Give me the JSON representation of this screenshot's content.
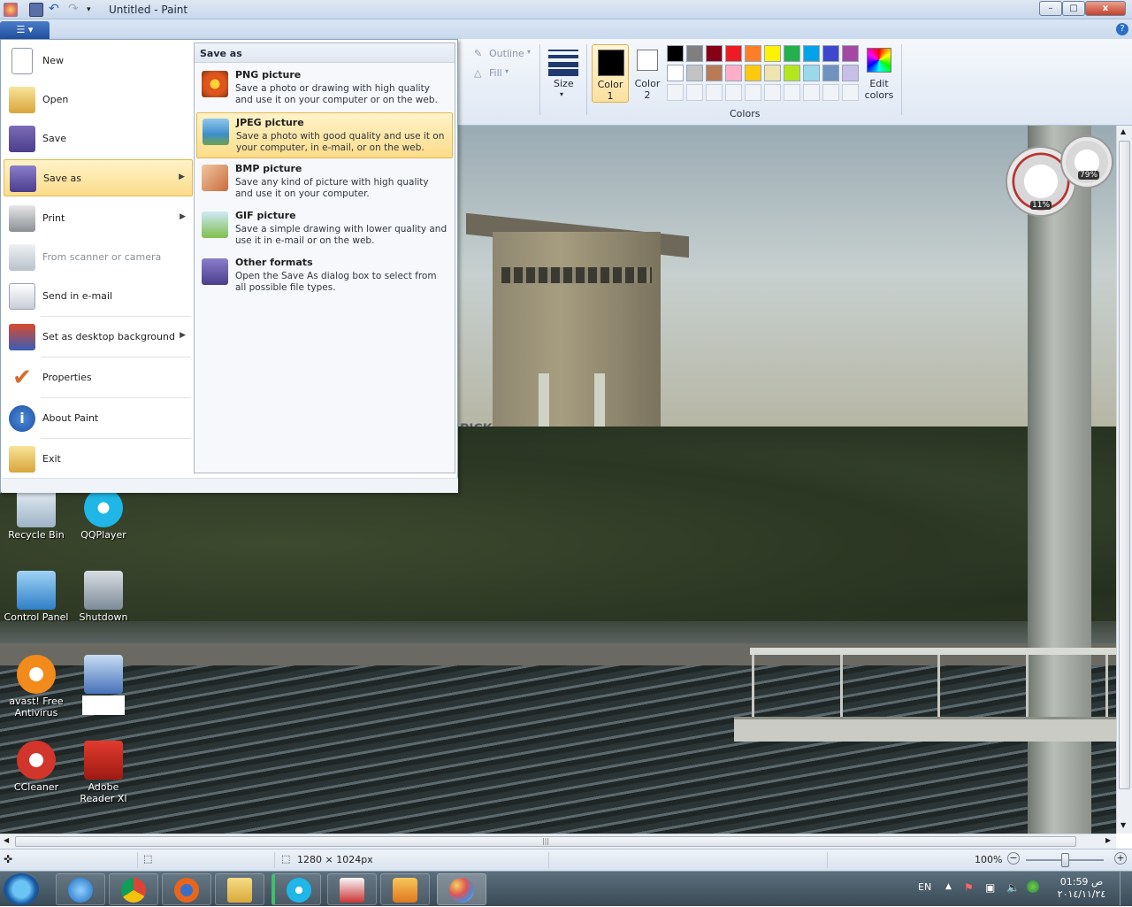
{
  "window": {
    "title": "Untitled - Paint",
    "minimize": "–",
    "maximize": "□",
    "close": "x"
  },
  "app_menu_button": "☰ ▾",
  "help": "?",
  "ribbon": {
    "outline": "Outline",
    "fill": "Fill",
    "size": "Size",
    "color1": "Color 1",
    "color2": "Color 2",
    "colors_group": "Colors",
    "edit_colors": "Edit colors",
    "palette_row1": [
      "#000000",
      "#7f7f7f",
      "#880015",
      "#ed1c24",
      "#ff7f27",
      "#fff200",
      "#22b14c",
      "#00a2e8",
      "#3f48cc",
      "#a349a4"
    ],
    "palette_row2": [
      "#ffffff",
      "#c3c3c3",
      "#b97a57",
      "#ffaec9",
      "#ffc90e",
      "#efe4b0",
      "#b5e61d",
      "#99d9ea",
      "#7092be",
      "#c8bfe7"
    ]
  },
  "menu": {
    "items": [
      {
        "label": "New"
      },
      {
        "label": "Open"
      },
      {
        "label": "Save"
      },
      {
        "label": "Save as"
      },
      {
        "label": "Print"
      },
      {
        "label": "From scanner or camera"
      },
      {
        "label": "Send in e-mail"
      },
      {
        "label": "Set as desktop background"
      },
      {
        "label": "Properties"
      },
      {
        "label": "About Paint"
      },
      {
        "label": "Exit"
      }
    ]
  },
  "submenu": {
    "header": "Save as",
    "options": [
      {
        "title": "PNG picture",
        "desc": "Save a photo or drawing with high quality and use it on your computer or on the web."
      },
      {
        "title": "JPEG picture",
        "desc": "Save a photo with good quality and use it on your computer, in e-mail, or on the web."
      },
      {
        "title": "BMP picture",
        "desc": "Save any kind of picture with high quality and use it on your computer."
      },
      {
        "title": "GIF picture",
        "desc": "Save a simple drawing with lower quality and use it in e-mail or on the web."
      },
      {
        "title": "Other formats",
        "desc": "Open the Save As dialog box to select from all possible file types."
      }
    ]
  },
  "desktop_icons": [
    {
      "label": "Recycle Bin"
    },
    {
      "label": "QQPlayer"
    },
    {
      "label": "Control Panel"
    },
    {
      "label": "Shutdown"
    },
    {
      "label": "avast! Free Antivirus"
    },
    {
      "label": "CCleaner"
    },
    {
      "label": "Adobe Reader XI"
    }
  ],
  "gauges": {
    "cpu": "11%",
    "mem": "79%"
  },
  "canvas_text": {
    "sign": "PICK"
  },
  "hscroll_grip": "|||",
  "status": {
    "dimensions": "1280 × 1024px",
    "zoom": "100%",
    "zoom_level": 1.0
  },
  "tray": {
    "lang": "EN",
    "time": "01:59 ص",
    "date": "٢٠١٤/١١/٢٤"
  }
}
